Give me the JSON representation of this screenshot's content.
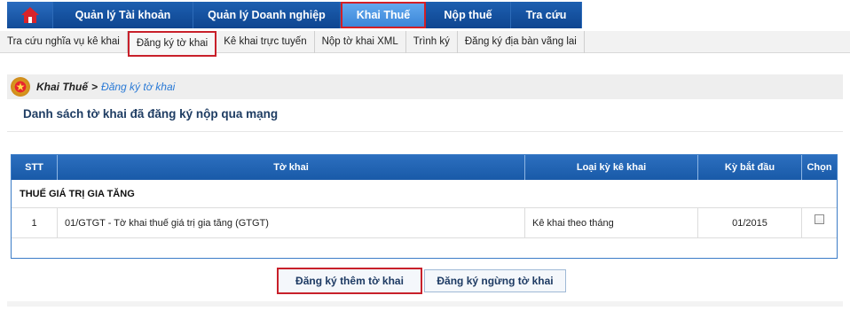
{
  "topnav": {
    "home_icon": "home-icon",
    "tabs": [
      {
        "label": "Quản lý Tài khoản"
      },
      {
        "label": "Quản lý Doanh nghiệp"
      },
      {
        "label": "Khai Thuế"
      },
      {
        "label": "Nộp thuế"
      },
      {
        "label": "Tra cứu"
      }
    ],
    "active_tab": "Khai Thuế"
  },
  "subnav": {
    "items": [
      {
        "label": "Tra cứu nghĩa vụ kê khai"
      },
      {
        "label": "Đăng ký tờ khai"
      },
      {
        "label": "Kê khai trực tuyến"
      },
      {
        "label": "Nộp tờ khai XML"
      },
      {
        "label": "Trình ký"
      },
      {
        "label": "Đăng ký địa bàn vãng lai"
      }
    ],
    "active_item": "Đăng ký tờ khai"
  },
  "breadcrumb": {
    "parent": "Khai Thuế",
    "separator": ">",
    "current": "Đăng ký tờ khai"
  },
  "page": {
    "title": "Danh sách tờ khai đã đăng ký nộp qua mạng"
  },
  "table": {
    "headers": [
      "STT",
      "Tờ khai",
      "Loại kỳ kê khai",
      "Kỳ bắt đầu",
      "Chọn"
    ],
    "group": "THUẾ GIÁ TRỊ GIA TĂNG",
    "rows": [
      {
        "stt": "1",
        "to_khai": "01/GTGT - Tờ khai thuế giá trị gia tăng (GTGT)",
        "loai_ky": "Kê khai theo tháng",
        "ky_bat_dau": "01/2015",
        "chon": false
      }
    ]
  },
  "buttons": {
    "register_more": "Đăng ký thêm tờ khai",
    "register_stop": "Đăng ký ngừng tờ khai"
  },
  "colors": {
    "nav_blue": "#0e4590",
    "active_tab": "#3c86d8",
    "highlight_red": "#c8202a",
    "link_blue": "#2a7ad6"
  }
}
